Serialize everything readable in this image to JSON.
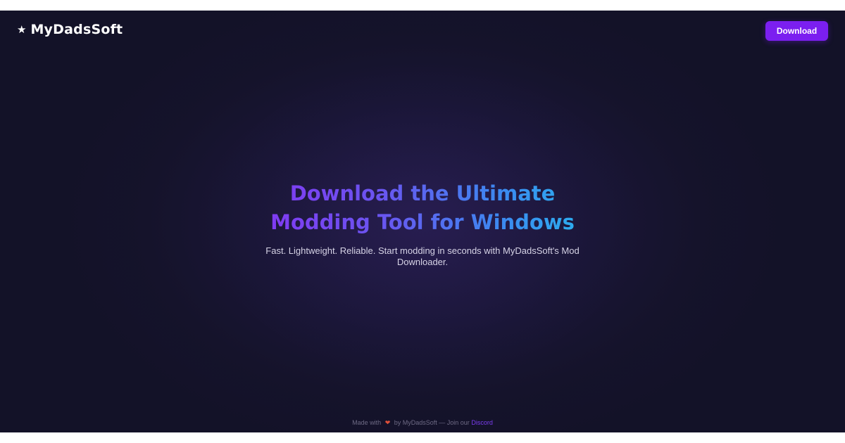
{
  "brand": {
    "star": "★",
    "name": "MyDadsSoft"
  },
  "header": {
    "download_label": "Download"
  },
  "hero": {
    "title_line1": "Download the Ultimate",
    "title_line2": "Modding Tool for Windows",
    "subtitle": "Fast. Lightweight. Reliable. Start modding in seconds with MyDadsSoft's Mod Downloader."
  },
  "footer": {
    "made_with": "Made with",
    "heart": "❤",
    "by_text": "by MyDadsSoft — Join our",
    "discord_link": "Discord"
  },
  "colors": {
    "background": "#17142f",
    "accent": "#7b1ff0",
    "title_gradient_start": "#8b2df3",
    "title_gradient_end": "#22c7ee",
    "heart": "#e0503a",
    "link": "#7b3cf0"
  },
  "icons": {
    "logo": "star-icon",
    "footer": "heart-icon"
  }
}
